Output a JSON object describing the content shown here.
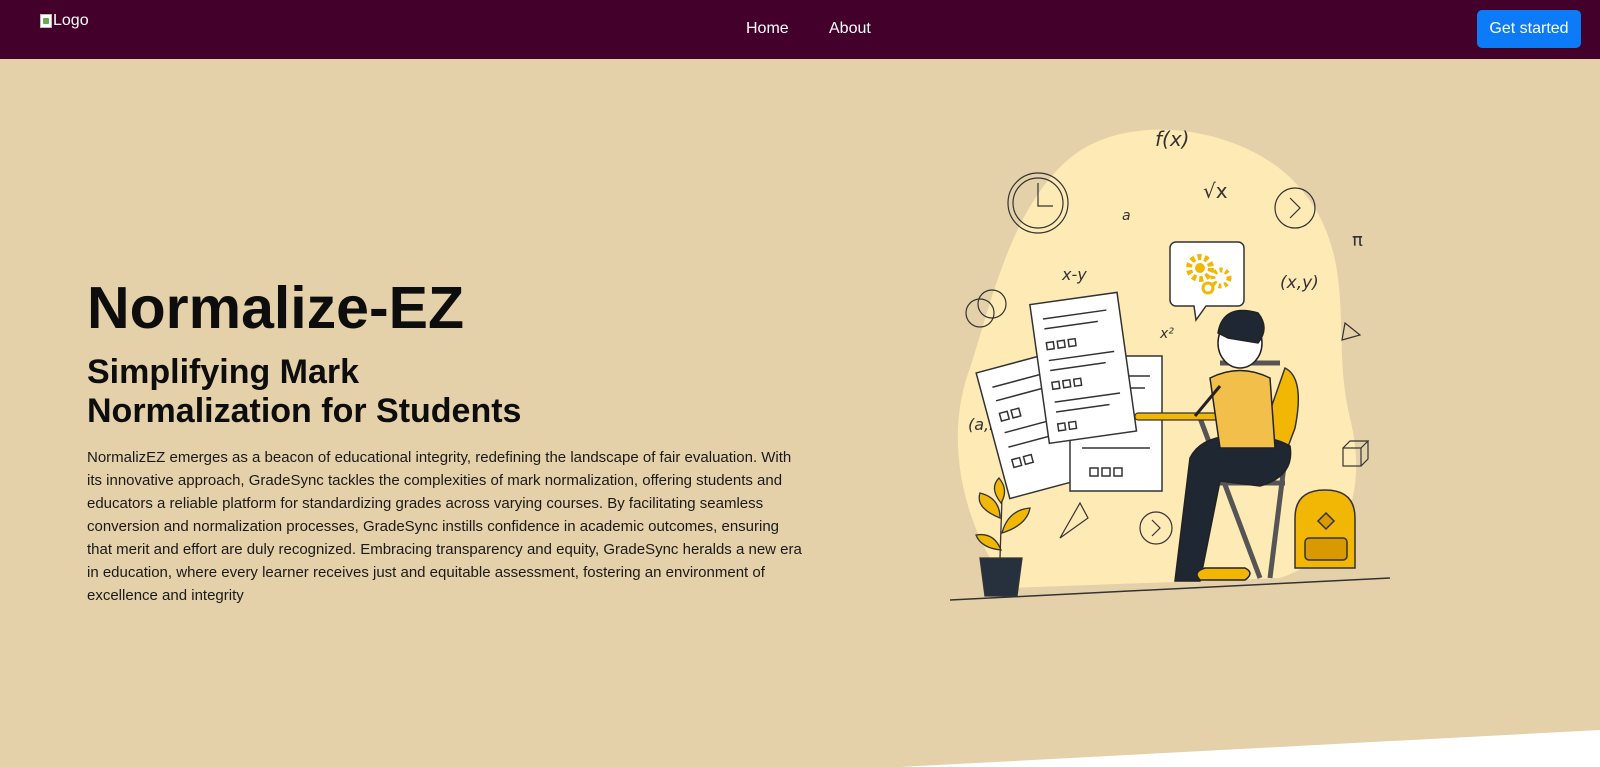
{
  "nav": {
    "logo_alt": "Logo",
    "links": [
      "Home",
      "About"
    ],
    "cta_label": "Get started"
  },
  "hero": {
    "title": "Normalize-EZ",
    "subtitle": "Simplifying Mark Normalization for Students",
    "description": "NormalizEZ emerges as a beacon of educational integrity, redefining the landscape of fair evaluation. With its innovative approach, GradeSync tackles the complexities of mark normalization, offering students and educators a reliable platform for standardizing grades across varying courses. By facilitating seamless conversion and normalization processes, GradeSync instills confidence in academic outcomes, ensuring that merit and effort are duly recognized. Embracing transparency and equity, GradeSync heralds a new era in education, where every learner receives just and equitable assessment, fostering an environment of excellence and integrity"
  },
  "illustration": {
    "name": "student-studying-illustration",
    "math_symbols": [
      "f(x)",
      "√x",
      "a",
      "x-y",
      "x²",
      "(x,y)",
      "(a,b)",
      "π"
    ]
  },
  "colors": {
    "nav_bg": "#42002a",
    "page_bg": "#e4d1a9",
    "cta_bg": "#0d7bf7",
    "accent_yellow": "#f2b705",
    "blob": "#fdeab5"
  }
}
